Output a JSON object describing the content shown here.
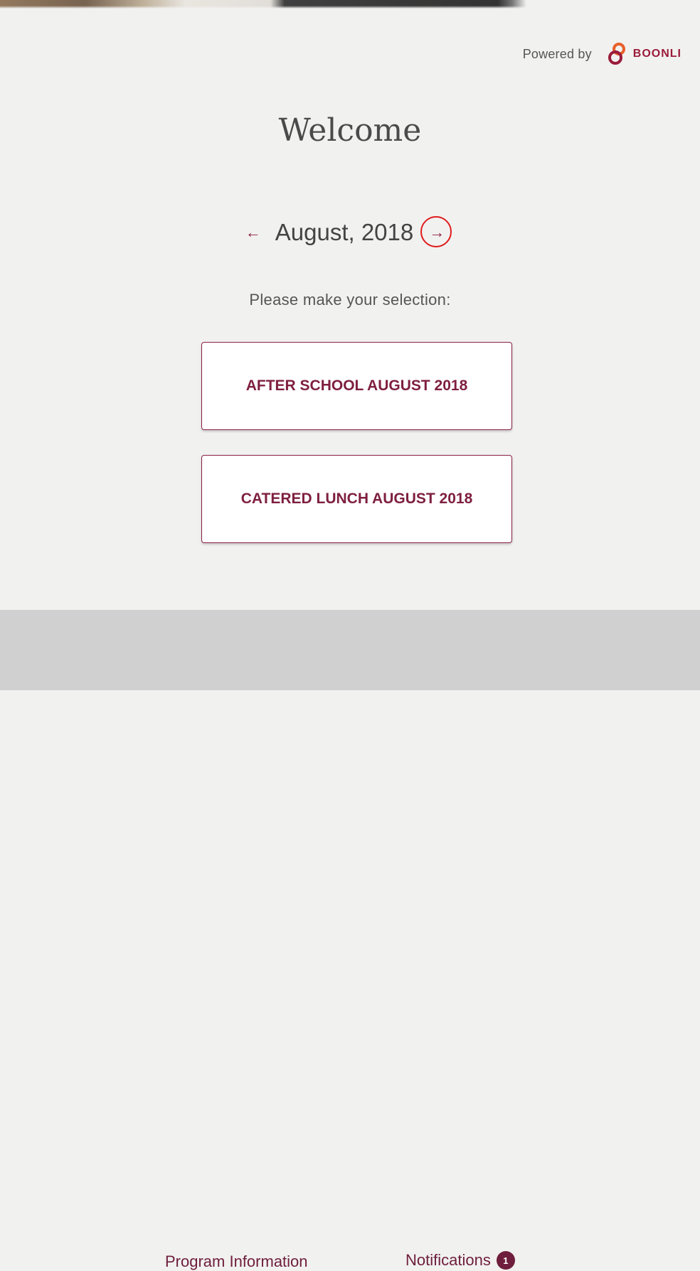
{
  "header": {
    "powered_by": "Powered by",
    "brand": "BOONLI"
  },
  "page": {
    "title": "Welcome"
  },
  "month_nav": {
    "prev_symbol": "←",
    "month": "August, 2018",
    "next_symbol": "→"
  },
  "selection": {
    "prompt": "Please make your selection:",
    "options": [
      {
        "label": "AFTER SCHOOL AUGUST 2018"
      },
      {
        "label": "CATERED LUNCH AUGUST 2018"
      }
    ]
  },
  "footer": {
    "program_info": "Program Information",
    "notifications": "Notifications",
    "notifications_count": "1"
  },
  "colors": {
    "accent": "#8a1f46",
    "brand": "#9b1b3a",
    "highlight_ring": "#e01b1b"
  }
}
